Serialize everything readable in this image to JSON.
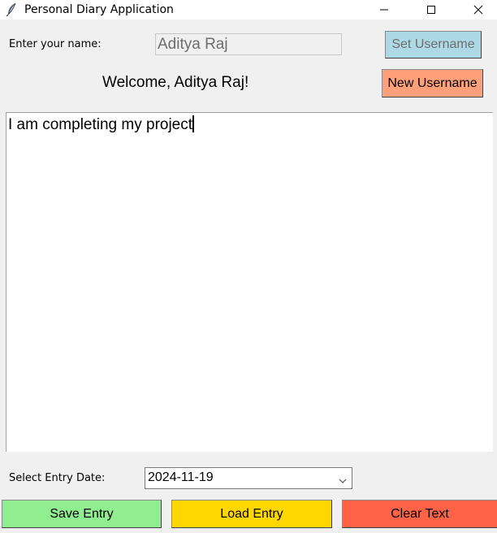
{
  "window": {
    "title": "Personal Diary Application",
    "app_icon": "feather-icon",
    "controls": {
      "minimize_icon": "minimize-icon",
      "maximize_icon": "maximize-icon",
      "close_icon": "close-icon"
    }
  },
  "username": {
    "label": "Enter your name:",
    "value": "Aditya Raj",
    "input_state": "disabled",
    "set_button": "Set Username",
    "new_button": "New Username",
    "welcome": "Welcome, Aditya Raj!"
  },
  "diary": {
    "text": "I am completing my project"
  },
  "date": {
    "label": "Select Entry Date:",
    "selected": "2024-11-19",
    "dropdown_icon": "chevron-down-icon"
  },
  "actions": {
    "save": "Save Entry",
    "load": "Load Entry",
    "clear": "Clear Text"
  },
  "colors": {
    "set_username_bg": "#add8e6",
    "new_username_bg": "#ffa07a",
    "save_bg": "#90ee90",
    "load_bg": "#ffd700",
    "clear_bg": "#ff6347",
    "window_bg": "#f0f0f0"
  }
}
